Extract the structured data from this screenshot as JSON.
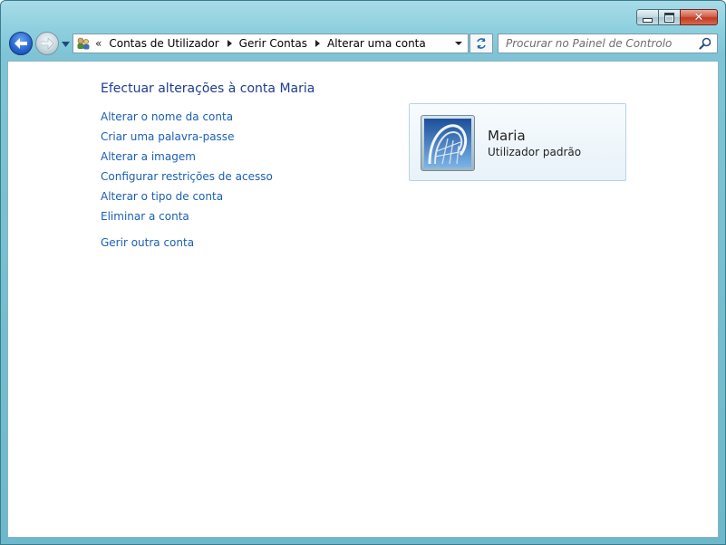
{
  "window": {
    "caption_buttons": {
      "minimize": "minimize-icon",
      "maximize": "maximize-icon",
      "close": "close-icon"
    }
  },
  "nav": {
    "back_icon": "back-arrow-icon",
    "forward_icon": "forward-arrow-icon",
    "history_icon": "chevron-down-icon"
  },
  "address": {
    "overflow": "«",
    "breadcrumbs": [
      "Contas de Utilizador",
      "Gerir Contas",
      "Alterar uma conta"
    ]
  },
  "search": {
    "placeholder": "Procurar no Painel de Controlo",
    "value": ""
  },
  "main": {
    "title": "Efectuar alterações à conta Maria",
    "tasks": [
      "Alterar o nome da conta",
      "Criar uma palavra-passe",
      "Alterar a imagem",
      "Configurar restrições de acesso",
      "Alterar o tipo de conta",
      "Eliminar a conta"
    ],
    "other_link": "Gerir outra conta"
  },
  "account": {
    "name": "Maria",
    "type": "Utilizador padrão",
    "picture_icon": "roller-coaster-avatar"
  },
  "colors": {
    "link": "#1a5fb4",
    "heading": "#1e3d8f",
    "frame": "#8fd0df",
    "close_button": "#c43a22"
  }
}
